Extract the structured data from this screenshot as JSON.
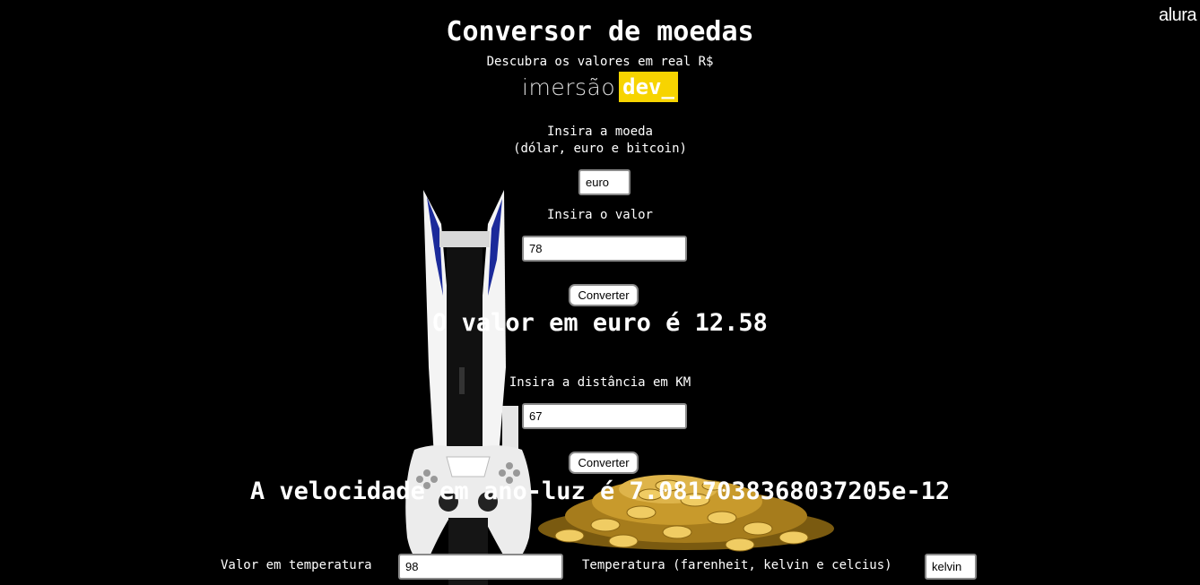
{
  "brand": {
    "corner_logo": "alura"
  },
  "header": {
    "title": "Conversor de moedas",
    "subtitle": "Descubra os valores em real R$",
    "logo_text": "imersão",
    "logo_tag": "dev_"
  },
  "currency": {
    "label_line1": "Insira a moeda",
    "label_line2": "(dólar, euro e bitcoin)",
    "currency_value": "euro",
    "amount_label": "Insira o valor",
    "amount_value": "78",
    "button_label": "Converter",
    "result": "O valor em euro é 12.58"
  },
  "distance": {
    "label": "Insira a distância em KM",
    "value": "67",
    "button_label": "Converter",
    "result": "A velocidade em ano-luz é 7.0817038368037205e-12"
  },
  "temperature": {
    "value_label": "Valor em temperatura",
    "value": "98",
    "unit_label": "Temperatura (farenheit, kelvin e celcius)",
    "unit_value": "kelvin"
  },
  "background": {
    "images": [
      "ps5-console",
      "gold-coins"
    ]
  }
}
